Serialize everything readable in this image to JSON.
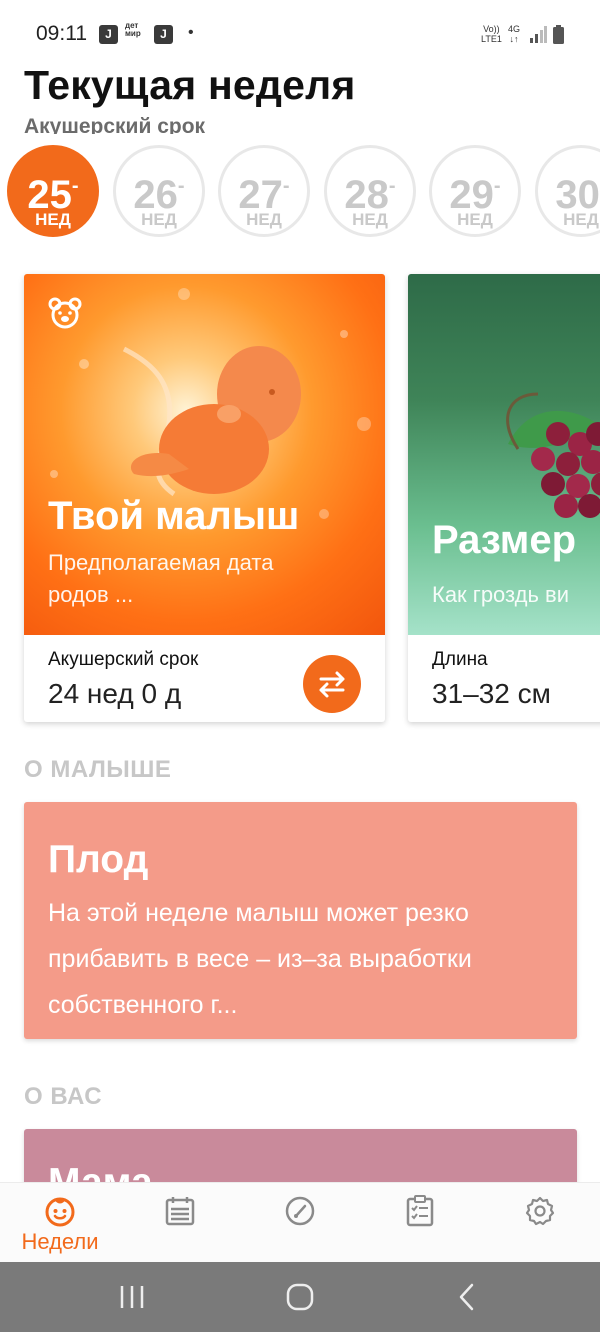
{
  "status_bar": {
    "time": "09:11",
    "app_badge": "J",
    "detmir_line1": "дет",
    "detmir_line2": "мир",
    "dot": "•",
    "volte_line1": "Vo))",
    "volte_line2": "LTE1",
    "network": "4G",
    "network_arrows": "↓↑"
  },
  "header": {
    "title": "Текущая неделя",
    "subtitle": "Акушерский срок"
  },
  "weeks": {
    "unit": "НЕД",
    "selected": "25",
    "items": [
      "25",
      "26",
      "27",
      "28",
      "29",
      "30"
    ]
  },
  "cards": [
    {
      "title": "Твой малыш",
      "description_line1": "Предполагаемая дата",
      "description_line2": "родов ...",
      "footer_label": "Акушерский срок",
      "footer_value": "24 нед 0 д",
      "icon": "bear-icon"
    },
    {
      "title": "Размер",
      "description_line1": "Как гроздь ви",
      "footer_label": "Длина",
      "footer_value": "31–32 см"
    }
  ],
  "sections": {
    "about_baby": {
      "label": "О МАЛЫШЕ",
      "card_title": "Плод",
      "card_text": "На этой неделе малыш может резко прибавить в весе – из–за выработки собственного г..."
    },
    "about_you": {
      "label": "О ВАС",
      "card_title": "Мама"
    }
  },
  "bottom_nav": {
    "active": "weeks",
    "items": [
      {
        "id": "weeks",
        "label": "Недели",
        "icon": "baby-face-icon"
      },
      {
        "id": "calendar",
        "label": "",
        "icon": "calendar-icon"
      },
      {
        "id": "tools",
        "label": "",
        "icon": "gauge-icon"
      },
      {
        "id": "checklist",
        "label": "",
        "icon": "checklist-icon"
      },
      {
        "id": "settings",
        "label": "",
        "icon": "gear-icon"
      }
    ]
  },
  "colors": {
    "accent": "#f26a1b",
    "fruit_card": "#f49b89",
    "mom_card": "#c98a9b",
    "section_label": "#c7c7c7"
  }
}
